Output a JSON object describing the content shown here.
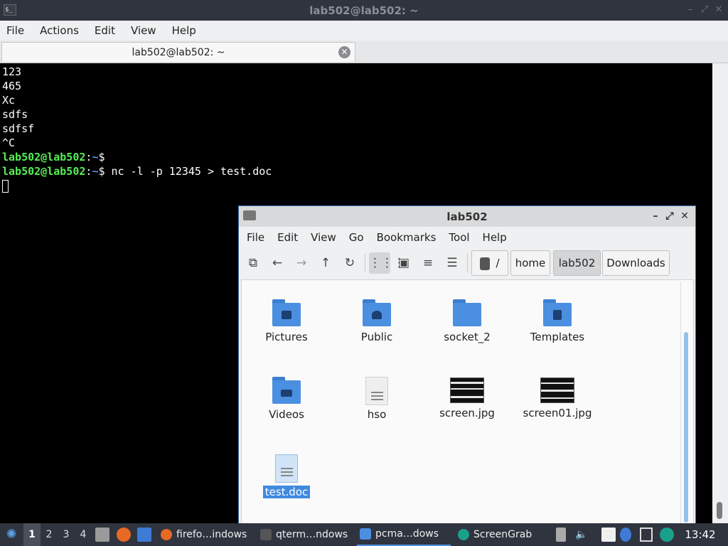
{
  "terminal": {
    "title": "lab502@lab502: ~",
    "icon_text": "$_",
    "menu": [
      "File",
      "Actions",
      "Edit",
      "View",
      "Help"
    ],
    "tab_title": "lab502@lab502: ~",
    "lines": [
      "123",
      "465",
      "Xc",
      "sdfs",
      "sdfsf",
      "^C"
    ],
    "prompt_user": "lab502@lab502",
    "prompt_sep": ":",
    "prompt_path": "~",
    "prompt_end": "$",
    "command": " nc -l -p 12345 > test.doc"
  },
  "file_manager": {
    "title": "lab502",
    "menu": [
      "File",
      "Edit",
      "View",
      "Go",
      "Bookmarks",
      "Tool",
      "Help"
    ],
    "path": {
      "root": "/",
      "crumbs": [
        "home",
        "lab502",
        "Downloads"
      ],
      "selected": "lab502"
    },
    "items": [
      {
        "name": "Pictures",
        "kind": "folder",
        "icon": "image-icon"
      },
      {
        "name": "Public",
        "kind": "folder",
        "icon": "person-icon"
      },
      {
        "name": "socket_2",
        "kind": "folder",
        "icon": "folder-icon"
      },
      {
        "name": "Templates",
        "kind": "folder",
        "icon": "template-icon"
      },
      {
        "name": "Videos",
        "kind": "folder",
        "icon": "video-icon"
      },
      {
        "name": "hso",
        "kind": "file",
        "icon": "text-file-icon"
      },
      {
        "name": "screen.jpg",
        "kind": "image",
        "icon": "image-thumbnail"
      },
      {
        "name": "screen01.jpg",
        "kind": "image",
        "icon": "image-thumbnail"
      },
      {
        "name": "test.doc",
        "kind": "file",
        "icon": "document-icon",
        "selected": true
      }
    ]
  },
  "taskbar": {
    "desktops": [
      "1",
      "2",
      "3",
      "4"
    ],
    "active_desktop": "1",
    "tasks": [
      {
        "label": "firefo…indows",
        "icon": "firefox-icon"
      },
      {
        "label": "qterm…ndows",
        "icon": "terminal-icon"
      },
      {
        "label": "pcma…dows",
        "icon": "folder-icon",
        "active": true
      },
      {
        "label": "ScreenGrab",
        "icon": "screengrab-icon"
      }
    ],
    "clock": "13:42"
  },
  "colors": {
    "accent": "#3f8ae0",
    "folder": "#4b8fe0",
    "prompt_user": "#55ee55",
    "prompt_path": "#5c8ff6",
    "panel": "#2f343f"
  }
}
